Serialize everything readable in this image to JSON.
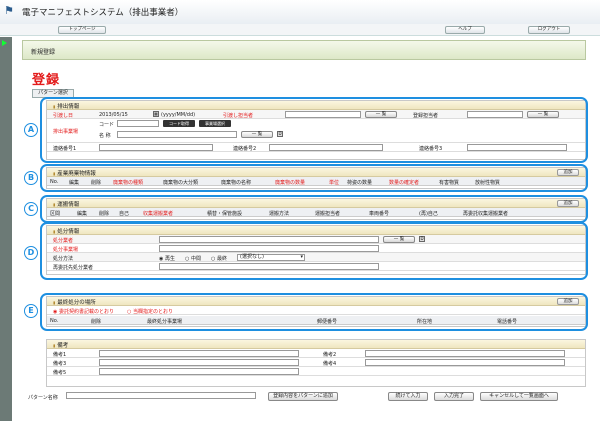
{
  "app": {
    "title": "電子マニフェストシステム（排出事業者）",
    "logo": "flag-logo"
  },
  "nav": {
    "top": "トップページ",
    "help": "ヘルプ",
    "logout": "ログアウト"
  },
  "page": {
    "breadcrumb": "新規登録",
    "title": "登録",
    "pattern_button": "パターン選択"
  },
  "markers": [
    "A",
    "B",
    "C",
    "D",
    "E"
  ],
  "sec_a": {
    "title": "排出情報",
    "date_label": "引渡し日",
    "date_value": "2013/05/15",
    "date_format": "(yyyy/MM/dd)",
    "person_label": "引渡し担当者",
    "list_btn": "一 覧",
    "reg_label": "登録担当者",
    "site_label": "排出事業場",
    "code_label": "コード",
    "name_label": "名 称",
    "code_btn1": "コード取得",
    "code_btn2": "事業場選択",
    "contact1": "連絡番号1",
    "contact2": "連絡番号2",
    "contact3": "連絡番号3"
  },
  "sec_b": {
    "title": "産業廃棄物情報",
    "add": "追加",
    "cols": [
      "No.",
      "編集",
      "削除",
      "廃棄物の種類",
      "廃棄物の大分類",
      "廃棄物の名称",
      "廃棄物の数量",
      "単位",
      "荷姿の数量",
      "数量の確定者",
      "有害物質",
      "放射性物質"
    ]
  },
  "sec_c": {
    "title": "運搬情報",
    "add": "追加",
    "cols": [
      "区間",
      "編集",
      "削除",
      "自己",
      "収集運搬業者",
      "積替・保管施設",
      "運搬方法",
      "運搬担当者",
      "車両番号",
      "(再)自己",
      "再委託収集運搬業者"
    ]
  },
  "sec_d": {
    "title": "処分情報",
    "disposer": "処分業者",
    "site": "処分事業場",
    "method": "処分方法",
    "radio1": "再生",
    "radio2": "中間",
    "radio3": "最終",
    "select": "(選択なし)",
    "reconsign": "再委託先処分業者",
    "list_btn": "一 覧"
  },
  "sec_e": {
    "title": "最終処分の場所",
    "add": "追加",
    "radio1": "委託契約書記載のとおり",
    "radio2": "当欄指定のとおり",
    "cols": [
      "No.",
      "削除",
      "最終処分事業場",
      "郵便番号",
      "所在地",
      "電話番号"
    ]
  },
  "notes": {
    "title": "備考",
    "n1": "備考1",
    "n2": "備考2",
    "n3": "備考3",
    "n4": "備考4",
    "n5": "備考5"
  },
  "footer": {
    "pattern_label": "パターン名称",
    "save_pattern": "登録内容をパターンに追加",
    "continue": "続けて入力",
    "done": "入力完了",
    "cancel": "キャンセルして一覧画面へ"
  }
}
